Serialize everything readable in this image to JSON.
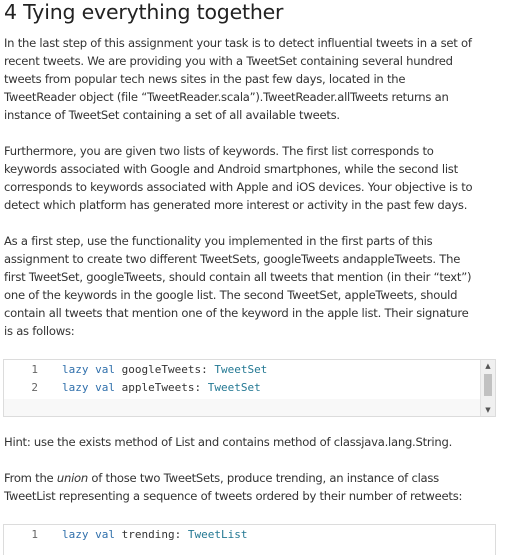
{
  "heading": "4 Tying everything together",
  "p1": [
    "In the last step of this assignment your task is to detect influential tweets in a set of",
    "recent tweets. We are providing you with a TweetSet containing several hundred",
    "tweets from popular tech news sites in the past few days, located in the",
    "TweetReader object (file “TweetReader.scala”).TweetReader.allTweets returns an",
    "instance of TweetSet containing a set of all available tweets."
  ],
  "p2": [
    "Furthermore, you are given two lists of keywords. The first list corresponds to",
    "keywords associated with Google and Android smartphones, while the second list",
    "corresponds to keywords associated with Apple and iOS devices. Your objective is to",
    "detect which platform has generated more interest or activity in the past few days."
  ],
  "p3": [
    "As a first step, use the functionality you implemented in the first parts of this",
    "assignment to create two different TweetSets, googleTweets andappleTweets. The",
    "first TweetSet, googleTweets, should contain all tweets that mention (in their “text”)",
    "one of the keywords in the google list. The second TweetSet, appleTweets, should",
    "contain all tweets that mention one of the keyword in the apple list. Their signature",
    "is as follows:"
  ],
  "code1": [
    {
      "num": "1",
      "kw": "lazy val",
      "name": "googleTweets:",
      "type": "TweetSet"
    },
    {
      "num": "2",
      "kw": "lazy val",
      "name": "appleTweets:",
      "type": "TweetSet"
    }
  ],
  "hint": "Hint: use the exists method of List and contains method of classjava.lang.String.",
  "p4": {
    "l1_pre": "From the ",
    "l1_em": "union",
    "l1_post": " of those two TweetSets, produce trending, an instance of class",
    "l2": "TweetList representing a sequence of tweets ordered by their number of retweets:"
  },
  "code2": [
    {
      "num": "1",
      "kw": "lazy val",
      "name": "trending:",
      "type": "TweetList"
    }
  ],
  "scroll": {
    "up": "▲",
    "down": "▼"
  },
  "colors": {
    "keyword": "#2f6fab",
    "type": "#237893",
    "text": "#333333"
  }
}
